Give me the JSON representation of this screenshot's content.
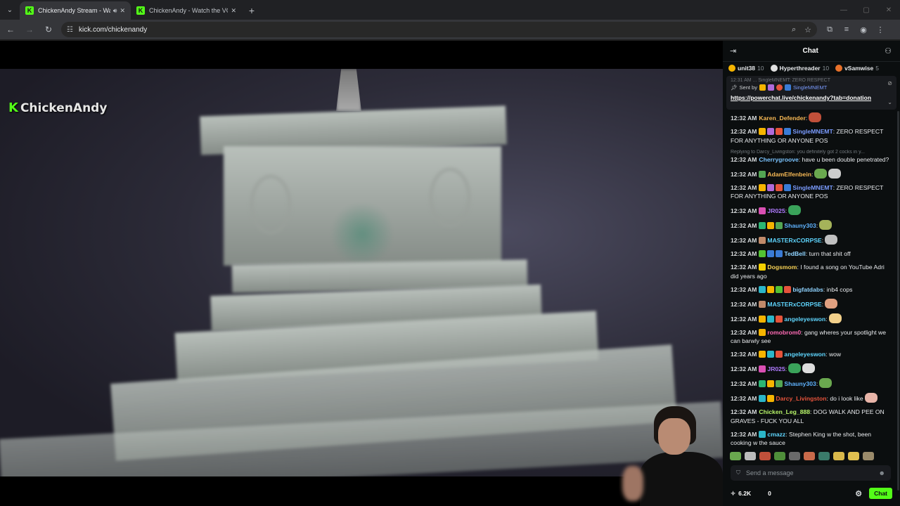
{
  "browser": {
    "tabs": [
      {
        "title": "ChickenAndy Stream - Watch",
        "active": true
      },
      {
        "title": "ChickenAndy - Watch the VOD",
        "active": false
      }
    ],
    "url": "kick.com/chickenandy"
  },
  "video": {
    "watermark": "ChickenAndy"
  },
  "chat": {
    "title": "Chat",
    "leaderboard": [
      {
        "name": "unit38",
        "count": "10",
        "color": "#f5b400"
      },
      {
        "name": "Hyperthreader",
        "count": "10",
        "color": "#e0e0e0"
      },
      {
        "name": "vSamwise",
        "count": "5",
        "color": "#e8712a"
      }
    ],
    "pinned": {
      "ghost_text": "12:31 AM ... SingleMNEMT: ZERO RESPECT",
      "sent_by_label": "Sent by",
      "sent_by_user": "SingleMNEMT",
      "link": "https://powerchat.live/chickenandy?tab=donation"
    },
    "messages": [
      {
        "time": "12:32 AM",
        "user": "Karen_Defender",
        "color": "#f7b955",
        "text": ":",
        "badges": [],
        "emotes": [
          "#c0503a"
        ]
      },
      {
        "time": "12:32 AM",
        "user": "SingleMNEMT",
        "color": "#7b9cff",
        "text": ": ZERO RESPECT FOR ANYTHING OR ANYONE POS",
        "badges": [
          "#f5b400",
          "#b06ad9",
          "#e5533b",
          "#3a7bd5"
        ],
        "emotes": []
      },
      {
        "time": "12:32 AM",
        "user": "Cherrygroove",
        "color": "#7bc4ff",
        "text": ": have u been double penetrated?",
        "badges": [],
        "emotes": [],
        "reply": "Replying to Darcy_Livingston: you definitely got 2 cocks in y..."
      },
      {
        "time": "12:32 AM",
        "user": "AdamElfenbein",
        "color": "#f7b955",
        "text": ":",
        "badges": [
          "#53a653"
        ],
        "emotes": [
          "#6aa84f",
          "#cccccc"
        ]
      },
      {
        "time": "12:32 AM",
        "user": "SingleMNEMT",
        "color": "#7b9cff",
        "text": ": ZERO RESPECT FOR ANYTHING OR ANYONE POS",
        "badges": [
          "#f5b400",
          "#b06ad9",
          "#e5533b",
          "#3a7bd5"
        ],
        "emotes": []
      },
      {
        "time": "12:32 AM",
        "user": "JR025",
        "color": "#b07bff",
        "text": ":",
        "badges": [
          "#d94fb3"
        ],
        "emotes": [
          "#3aa35a"
        ]
      },
      {
        "time": "12:32 AM",
        "user": "Shauny303",
        "color": "#5fb3ff",
        "text": ":",
        "badges": [
          "#2bb673",
          "#f5b400",
          "#53a653"
        ],
        "emotes": [
          "#a5b35a"
        ]
      },
      {
        "time": "12:32 AM",
        "user": "MASTERxCORPSE",
        "color": "#5fd6ff",
        "text": ":",
        "badges": [
          "#c08a6a"
        ],
        "emotes": [
          "#c0c0c0"
        ]
      },
      {
        "time": "12:32 AM",
        "user": "TedBell",
        "color": "#8fd3ff",
        "text": ": turn that shit off",
        "badges": [
          "#53c233",
          "#3a7bd5",
          "#3a7bd5"
        ],
        "emotes": []
      },
      {
        "time": "12:32 AM",
        "user": "Dogsmom",
        "color": "#f7d155",
        "text": ": I found a song on YouTube Adri did years ago",
        "badges": [
          "#f5d000"
        ],
        "emotes": []
      },
      {
        "time": "12:32 AM",
        "user": "bigfatdabs",
        "color": "#8fd3ff",
        "text": ": inb4 cops",
        "badges": [
          "#2bb6c9",
          "#f5b400",
          "#53c233",
          "#e5533b"
        ],
        "emotes": []
      },
      {
        "time": "12:32 AM",
        "user": "MASTERxCORPSE",
        "color": "#5fd6ff",
        "text": ":",
        "badges": [
          "#c08a6a"
        ],
        "emotes": [
          "#e0a080"
        ]
      },
      {
        "time": "12:32 AM",
        "user": "angeleyeswon",
        "color": "#5fd6ff",
        "text": ":",
        "badges": [
          "#f5b400",
          "#2bb6c9",
          "#e5533b"
        ],
        "emotes": [
          "#f2d08a"
        ]
      },
      {
        "time": "12:32 AM",
        "user": "romobrom0",
        "color": "#ff6bb5",
        "text": ": gang wheres your spotlight we can barwly see",
        "badges": [
          "#f5b400"
        ],
        "emotes": []
      },
      {
        "time": "12:32 AM",
        "user": "angeleyeswon",
        "color": "#5fd6ff",
        "text": ": wow",
        "badges": [
          "#f5b400",
          "#2bb6c9",
          "#e5533b"
        ],
        "emotes": []
      },
      {
        "time": "12:32 AM",
        "user": "JR025",
        "color": "#b07bff",
        "text": ":",
        "badges": [
          "#d94fb3"
        ],
        "emotes": [
          "#3aa35a",
          "#dddddd"
        ]
      },
      {
        "time": "12:32 AM",
        "user": "Shauny303",
        "color": "#5fb3ff",
        "text": ":",
        "badges": [
          "#2bb673",
          "#f5b400",
          "#53a653"
        ],
        "emotes": [
          "#6aa84f"
        ]
      },
      {
        "time": "12:32 AM",
        "user": "Darcy_Livingston",
        "color": "#e5533b",
        "text": ": do i look like",
        "badges": [
          "#2bb6c9",
          "#f5b400"
        ],
        "emotes": [
          "#e8b4a8"
        ]
      },
      {
        "time": "12:32 AM",
        "user": "Chicken_Leg_888",
        "color": "#b8f56a",
        "text": ": DOG WALK AND PEE ON GRAVES - FUCK YOU ALL",
        "badges": [],
        "emotes": []
      },
      {
        "time": "12:32 AM",
        "user": "cmazz",
        "color": "#5fd6ff",
        "text": ": Stephen King w the shot, been cooking w the sauce",
        "badges": [
          "#2bb6c9"
        ],
        "emotes": []
      }
    ],
    "input_placeholder": "Send a message",
    "viewers": "6.2K",
    "count_zero": "0",
    "chat_button": "Chat"
  }
}
